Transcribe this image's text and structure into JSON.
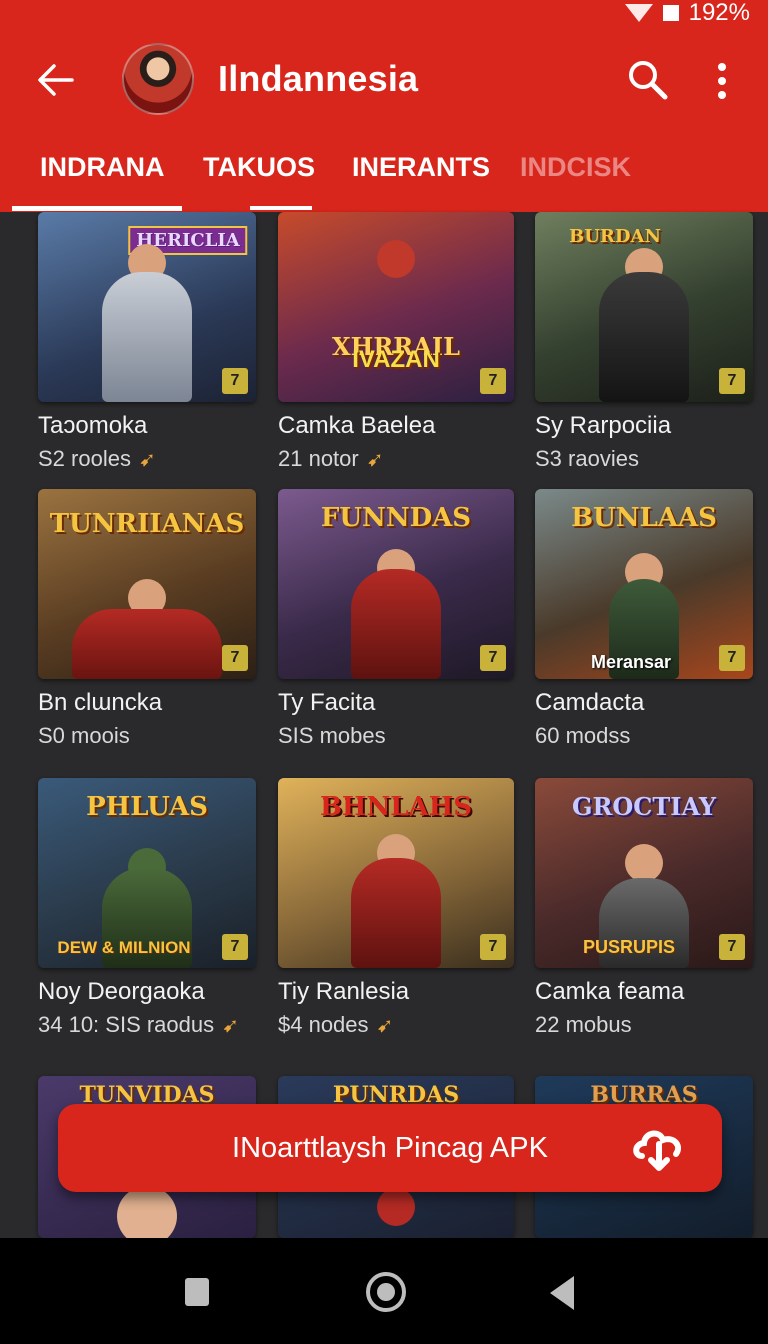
{
  "status": {
    "battery": "192%"
  },
  "header": {
    "title": "Ilndannesia"
  },
  "tabs": [
    {
      "label": "INDRANA",
      "active": true
    },
    {
      "label": "TAKUOS",
      "active": false
    },
    {
      "label": "INERANTS",
      "active": false
    },
    {
      "label": "INDCISK",
      "active": false
    }
  ],
  "cards": [
    {
      "title": "Taɔomoka",
      "sub": "S2 rooles",
      "spark": true,
      "banner": "HERICLIA",
      "banner2": ""
    },
    {
      "title": "Camka Baelea",
      "sub": "21 notor",
      "spark": true,
      "banner": "XHRRAIL",
      "banner2": "IVAZAN"
    },
    {
      "title": "Sy Rarpociia",
      "sub": "S3 raovies",
      "spark": false,
      "banner": "BURDAN",
      "banner2": ""
    },
    {
      "title": "Bn clɯncka",
      "sub": "S0 moois",
      "spark": false,
      "banner": "TUNRIIANAS",
      "banner2": ""
    },
    {
      "title": "Ty Facita",
      "sub": "SIS mobes",
      "spark": false,
      "banner": "FUNNDAS",
      "banner2": ""
    },
    {
      "title": "Camdacta",
      "sub": "60 modss",
      "spark": false,
      "banner": "BUNLAAS",
      "banner2": "Meransar"
    },
    {
      "title": "Noy Deorgaoka",
      "sub": "34 10: SIS raodus",
      "spark": true,
      "banner": "PHLUAS",
      "banner2": "DEW & MILNION"
    },
    {
      "title": "Tiy Ranlesia",
      "sub": "$4 nodes",
      "spark": true,
      "banner": "BHNLAHS",
      "banner2": ""
    },
    {
      "title": "Camka feama",
      "sub": "22 mobus",
      "spark": false,
      "banner": "GROCTIAY",
      "banner2": "PUSRUPIS"
    },
    {
      "title": "",
      "sub": "",
      "spark": false,
      "banner": "TUNVIDAS",
      "banner2": ""
    },
    {
      "title": "",
      "sub": "",
      "spark": false,
      "banner": "PUNRDAS",
      "banner2": ""
    },
    {
      "title": "",
      "sub": "",
      "spark": false,
      "banner": "BURRAS",
      "banner2": ""
    }
  ],
  "badge": "7",
  "fab": {
    "label": "INoarttlaysh Pincag APK"
  },
  "colors": {
    "primary": "#d9261c",
    "background": "#2a2a2c",
    "badge": "#c9b23a"
  },
  "icons": [
    "back-arrow-icon",
    "search-icon",
    "more-vert-icon",
    "download-icon",
    "recent-apps-icon",
    "home-icon",
    "back-icon"
  ]
}
